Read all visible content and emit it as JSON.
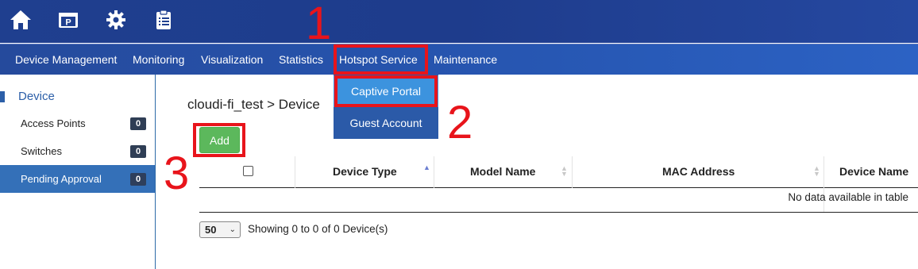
{
  "topbar": {
    "icons": [
      "home-icon",
      "parking-icon",
      "gear-icon",
      "clipboard-icon"
    ]
  },
  "nav": {
    "items": [
      "Device Management",
      "Monitoring",
      "Visualization",
      "Statistics",
      "Hotspot Service",
      "Maintenance"
    ]
  },
  "dropdown": {
    "items": [
      "Captive Portal",
      "Guest Account"
    ],
    "active": "Captive Portal"
  },
  "sidebar": {
    "heading": "Device",
    "items": [
      {
        "label": "Access Points",
        "count": "0"
      },
      {
        "label": "Switches",
        "count": "0"
      },
      {
        "label": "Pending Approval",
        "count": "0"
      }
    ],
    "selected": "Pending Approval"
  },
  "main": {
    "breadcrumb": "cloudi-fi_test > Device",
    "add_label": "Add",
    "columns": [
      "Device Type",
      "Model Name",
      "MAC Address",
      "Device Name"
    ],
    "empty_text": "No data available in table",
    "page_size": "50",
    "info": "Showing 0 to 0 of 0 Device(s)"
  },
  "annotations": [
    "1",
    "2",
    "3"
  ],
  "colors": {
    "topbar": "#1f3f8f",
    "navbar": "#2757b3",
    "accent": "#2c5fa8",
    "add_button": "#5cb85c",
    "annotation": "#e8141b"
  }
}
